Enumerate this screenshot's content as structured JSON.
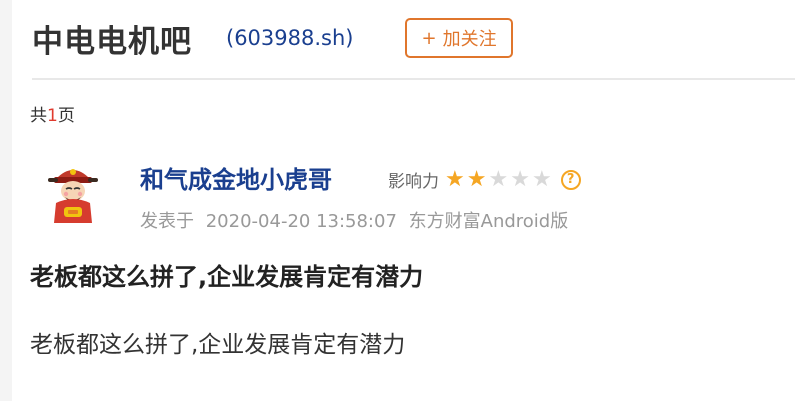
{
  "header": {
    "title": "中电电机吧",
    "stock_code": "(603988.sh)",
    "follow_button": {
      "plus": "+",
      "label": "加关注"
    }
  },
  "pagination": {
    "prefix": "共",
    "count": "1",
    "suffix": "页"
  },
  "post": {
    "author": "和气成金地小虎哥",
    "influence_label": "影响力",
    "influence_stars": {
      "filled": 2,
      "total": 5
    },
    "help_icon_text": "?",
    "posted_prefix": "发表于",
    "posted_time": "2020-04-20 13:58:07",
    "source": "东方财富Android版",
    "title": "老板都这么拼了,企业发展肯定有潜力",
    "body": "老板都这么拼了,企业发展肯定有潜力"
  },
  "colors": {
    "accent_orange": "#e0762c",
    "link_blue": "#1a3f8f",
    "star_on": "#f5a623",
    "star_off": "#d9d9d9",
    "page_number_red": "#e03a2e"
  },
  "icons": {
    "avatar": "caishen-avatar-icon",
    "star": "star-icon",
    "help": "question-circle-icon"
  }
}
